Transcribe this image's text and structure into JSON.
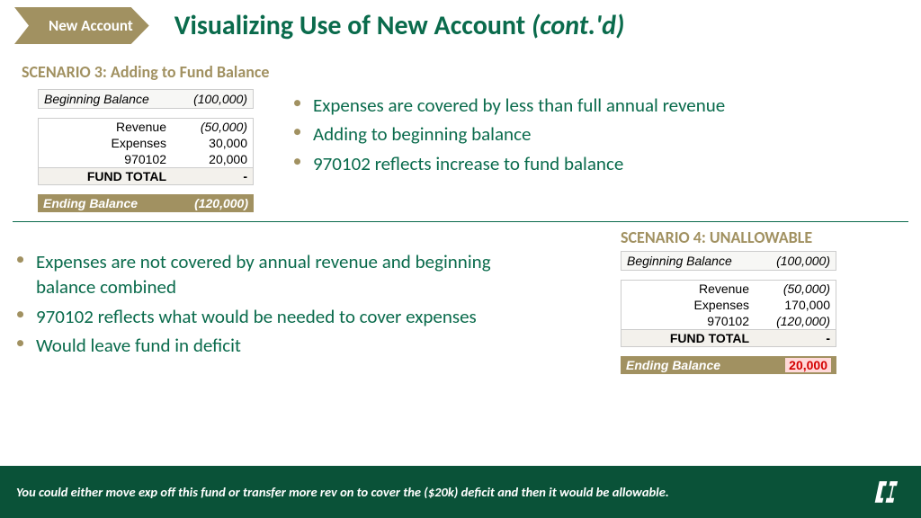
{
  "tag": "New Account",
  "title_main": "Visualizing Use of New Account ",
  "title_em": "(cont.'d)",
  "scenario3": {
    "label": "SCENARIO 3: Adding to Fund Balance",
    "table": {
      "begin_label": "Beginning Balance",
      "begin_val": "(100,000)",
      "rows": [
        {
          "label": "Revenue",
          "val": "(50,000)",
          "italic": true
        },
        {
          "label": "Expenses",
          "val": "30,000",
          "italic": false
        },
        {
          "label": "970102",
          "val": "20,000",
          "italic": false
        }
      ],
      "fund_total_label": "FUND TOTAL",
      "fund_total_val": "-",
      "ending_label": "Ending Balance",
      "ending_val": "(120,000)"
    },
    "bullets": [
      "Expenses are covered by less than full annual revenue",
      "Adding to beginning balance",
      "970102 reflects increase to fund balance"
    ]
  },
  "scenario4": {
    "label": "SCENARIO 4: UNALLOWABLE",
    "table": {
      "begin_label": "Beginning Balance",
      "begin_val": "(100,000)",
      "rows": [
        {
          "label": "Revenue",
          "val": "(50,000)",
          "italic": true
        },
        {
          "label": "Expenses",
          "val": "170,000",
          "italic": false
        },
        {
          "label": "970102",
          "val": "(120,000)",
          "italic": true
        }
      ],
      "fund_total_label": "FUND TOTAL",
      "fund_total_val": "-",
      "ending_label": "Ending Balance",
      "ending_val": "20,000"
    },
    "bullets": [
      "Expenses are not covered by annual revenue and beginning balance combined",
      "970102 reflects what would be needed to cover expenses",
      "Would leave fund in deficit"
    ]
  },
  "footer": "You could either move exp off this fund or transfer more rev on to cover the ($20k) deficit and then it would be allowable."
}
